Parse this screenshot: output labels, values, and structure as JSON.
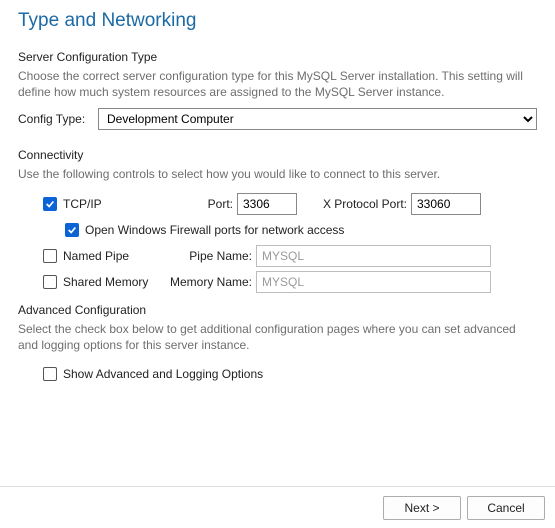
{
  "title": "Type and Networking",
  "server_config": {
    "heading": "Server Configuration Type",
    "desc": "Choose the correct server configuration type for this MySQL Server installation. This setting will define how much system resources are assigned to the MySQL Server instance.",
    "label": "Config Type:",
    "value": "Development Computer"
  },
  "connectivity": {
    "heading": "Connectivity",
    "desc": "Use the following controls to select how you would like to connect to this server.",
    "tcpip": {
      "checked": true,
      "label": "TCP/IP",
      "port_label": "Port:",
      "port_value": "3306",
      "xport_label": "X Protocol Port:",
      "xport_value": "33060"
    },
    "firewall": {
      "checked": true,
      "label": "Open Windows Firewall ports for network access"
    },
    "named_pipe": {
      "checked": false,
      "label": "Named Pipe",
      "name_label": "Pipe Name:",
      "value": "MYSQL"
    },
    "shared_memory": {
      "checked": false,
      "label": "Shared Memory",
      "name_label": "Memory Name:",
      "value": "MYSQL"
    }
  },
  "advanced": {
    "heading": "Advanced Configuration",
    "desc": "Select the check box below to get additional configuration pages where you can set advanced and logging options for this server instance.",
    "checkbox": {
      "checked": false,
      "label": "Show Advanced and Logging Options"
    }
  },
  "buttons": {
    "next": "Next >",
    "cancel": "Cancel"
  }
}
